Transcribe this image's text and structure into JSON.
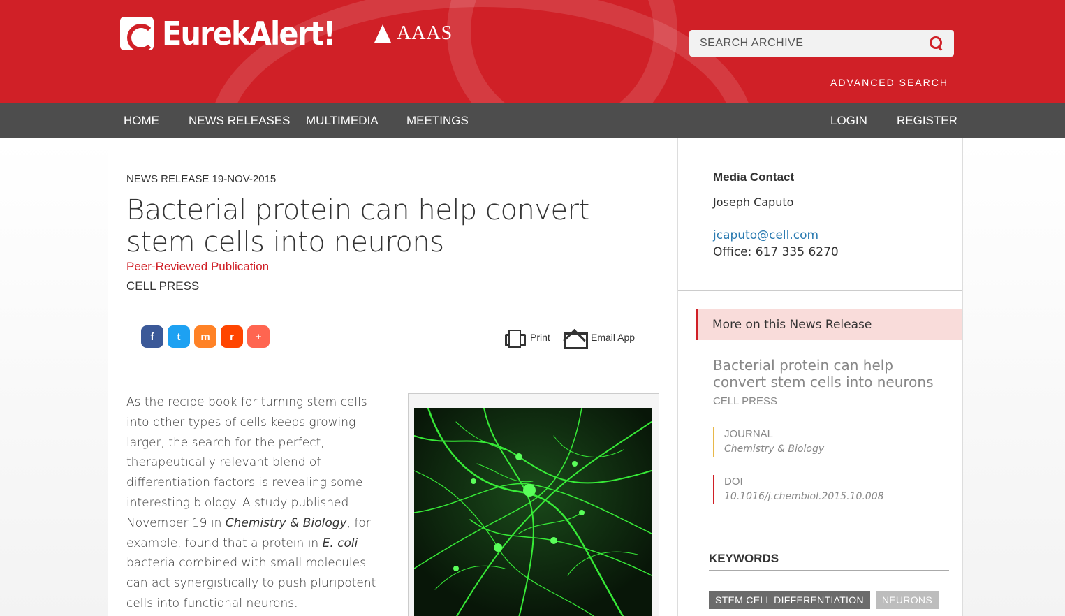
{
  "brand": {
    "logo_text": "EurekAlert!",
    "partner_text": "AAAS",
    "accent_color": "#d02027"
  },
  "search": {
    "placeholder": "SEARCH ARCHIVE",
    "advanced_label": "ADVANCED SEARCH"
  },
  "nav": {
    "home": "HOME",
    "news_releases": "NEWS RELEASES",
    "multimedia": "MULTIMEDIA",
    "meetings": "MEETINGS",
    "login": "LOGIN",
    "register": "REGISTER"
  },
  "article": {
    "release_date": "NEWS RELEASE 19-NOV-2015",
    "title": "Bacterial protein can help convert stem cells into neurons",
    "publication_type": "Peer-Reviewed Publication",
    "institution": "CELL PRESS",
    "body_part1": "As the recipe book for turning stem cells into other types of cells keeps growing larger, the search for the perfect, therapeutically relevant blend of differentiation factors is revealing some interesting biology. A study published November 19 in ",
    "body_journal": "Chemistry & Biology",
    "body_part2": ", for example, found that a protein in ",
    "body_species": "E. coli",
    "body_part3": " bacteria combined with small molecules can act synergistically to push pluripotent cells into functional neurons."
  },
  "share": {
    "facebook_icon": "f",
    "twitter_icon": "t",
    "mix_icon": "m",
    "reddit_icon": "r",
    "more_icon": "+",
    "colors": [
      "#3b5998",
      "#1da1f2",
      "#ff8226",
      "#ff4500",
      "#ff6550"
    ]
  },
  "actions": {
    "print_label": "Print",
    "email_label": "Email App"
  },
  "sidebar": {
    "media_contact_title": "Media Contact",
    "contact_name": "Joseph Caputo",
    "contact_email": "jcaputo@cell.com",
    "contact_phone": "Office: 617 335 6270",
    "more_title": "More on this News Release",
    "related_title": "Bacterial protein can help convert stem cells into neurons",
    "related_institution": "CELL PRESS",
    "journal_label": "JOURNAL",
    "journal_value": "Chemistry & Biology",
    "doi_label": "DOI",
    "doi_value": "10.1016/j.chembiol.2015.10.008",
    "keywords_title": "KEYWORDS",
    "keywords": [
      "STEM CELL DIFFERENTIATION",
      "NEURONS"
    ]
  }
}
